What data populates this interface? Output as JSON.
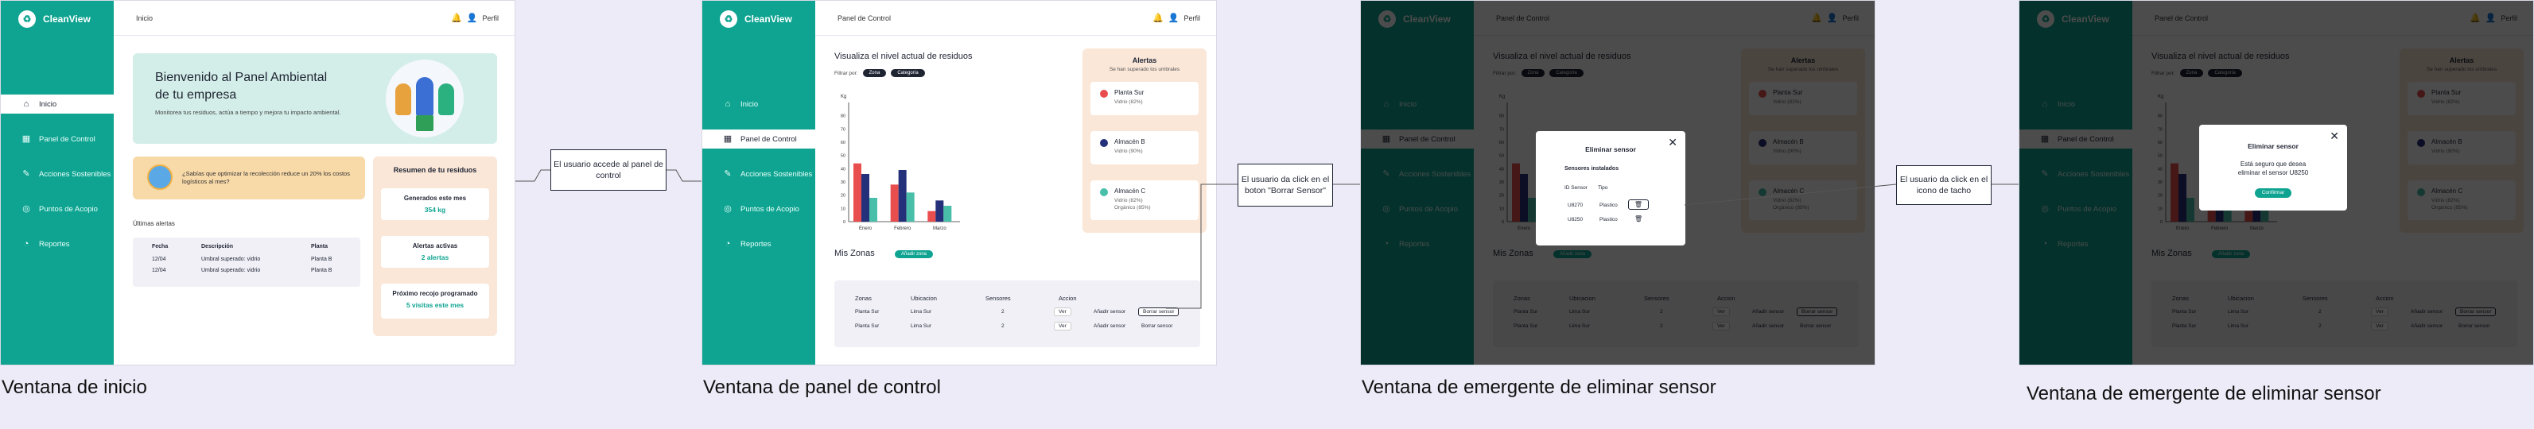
{
  "brand": {
    "name": "CleanView",
    "logo_glyph": "♻"
  },
  "nav": {
    "items": [
      {
        "label": "Inicio",
        "icon": "home-icon",
        "glyph": "⌂"
      },
      {
        "label": "Panel de Control",
        "icon": "dashboard-icon",
        "glyph": "▦"
      },
      {
        "label": "Acciones Sostenibles",
        "icon": "leaf-icon",
        "glyph": "✎"
      },
      {
        "label": "Puntos de Acopio",
        "icon": "location-icon",
        "glyph": "◎"
      },
      {
        "label": "Reportes",
        "icon": "report-icon",
        "glyph": "◔"
      }
    ]
  },
  "topbar": {
    "profile_label": "Perfil",
    "bell_glyph": "🔔",
    "user_glyph": "👤"
  },
  "inicio": {
    "breadcrumb": "Inicio",
    "banner_title": "Bienvenido al Panel Ambiental de tu empresa",
    "banner_text": "Monitorea tus residuos, actúa a tiempo y mejora tu impacto ambiental.",
    "tip_text": "¿Sabías que optimizar la recolección reduce un 20% los costos logísticos al mes?",
    "alerts_title": "Últimas alertas",
    "alerts_headers": [
      "Fecha",
      "Descripción",
      "Planta"
    ],
    "alerts_rows": [
      [
        "12/04",
        "Umbral superado: vidrio",
        "Planta B"
      ],
      [
        "12/04",
        "Umbral superado: vidrio",
        "Planta B"
      ]
    ],
    "summary_title": "Resumen de tu residuos",
    "cards": [
      {
        "label": "Generados este mes",
        "value": "354 kg"
      },
      {
        "label": "Alertas activas",
        "value": "2 alertas"
      },
      {
        "label": "Próximo recojo programado",
        "value": "5 visitas este mes"
      }
    ]
  },
  "panel": {
    "breadcrumb": "Panel de Control",
    "title": "Visualiza el nivel actual de residuos",
    "filter_label": "Filtrar por:",
    "filter_chips": [
      "Zona",
      "Categoría"
    ],
    "alerts_title": "Alertas",
    "alerts_sub": "Se han superado los umbrales",
    "alerts": [
      {
        "name": "Planta Sur",
        "desc": "Vidrio (82%)",
        "color": "#e94e4e"
      },
      {
        "name": "Almacén B",
        "desc": "Vidrio (90%)",
        "color": "#25307a"
      },
      {
        "name": "Almacén C",
        "desc": "Vidrio (82%)\nOrgánico (85%)",
        "color": "#49bfa9"
      }
    ],
    "zones_title": "Mis Zonas",
    "zones_chip": "Añadir zona",
    "zones_headers": [
      "Zonas",
      "Ubicacion",
      "Sensores",
      "Accion"
    ],
    "zones_rows": [
      {
        "zona": "Planta Sur",
        "ubicacion": "Lima Sur",
        "sensores": "2",
        "ver": "Ver",
        "add": "Añadir sensor",
        "del": "Borrar sensor"
      },
      {
        "zona": "Planta Sur",
        "ubicacion": "Lima Sur",
        "sensores": "2",
        "ver": "Ver",
        "add": "Añadir sensor",
        "del": "Borrar sensor"
      }
    ]
  },
  "chart_data": {
    "type": "bar",
    "categories": [
      "Enero",
      "Febrero",
      "Marzo"
    ],
    "series": [
      {
        "color": "#e94e4e",
        "values": [
          44,
          28,
          8
        ]
      },
      {
        "color": "#25307a",
        "values": [
          36,
          39,
          16
        ]
      },
      {
        "color": "#49bfa9",
        "values": [
          18,
          22,
          12
        ]
      }
    ],
    "ylabel": "Kg",
    "ylim": [
      0,
      90
    ],
    "yticks": [
      0,
      10,
      20,
      30,
      40,
      50,
      60,
      70,
      80
    ]
  },
  "modal_list": {
    "title": "Eliminar sensor",
    "subtitle": "Sensores instalados",
    "headers": [
      "ID Sensor",
      "Tipo"
    ],
    "rows": [
      [
        "U8270",
        "Plastico"
      ],
      [
        "U8250",
        "Plastico"
      ]
    ],
    "close_glyph": "✕",
    "trash_glyph": "🗑"
  },
  "modal_confirm": {
    "title": "Eliminar sensor",
    "text": "Está seguro que desea eliminar el sensor U8250",
    "button": "Confirmar",
    "close_glyph": "✕"
  },
  "flow_notes": [
    "El usuario accede al panel de control",
    "El usuario da click en el boton \"Borrar Sensor\"",
    "El usuario da click en el icono de tacho"
  ],
  "captions": [
    "Ventana de inicio",
    "Ventana de panel de control",
    "Ventana de emergente de eliminar sensor",
    "Ventana de emergente de eliminar sensor"
  ]
}
